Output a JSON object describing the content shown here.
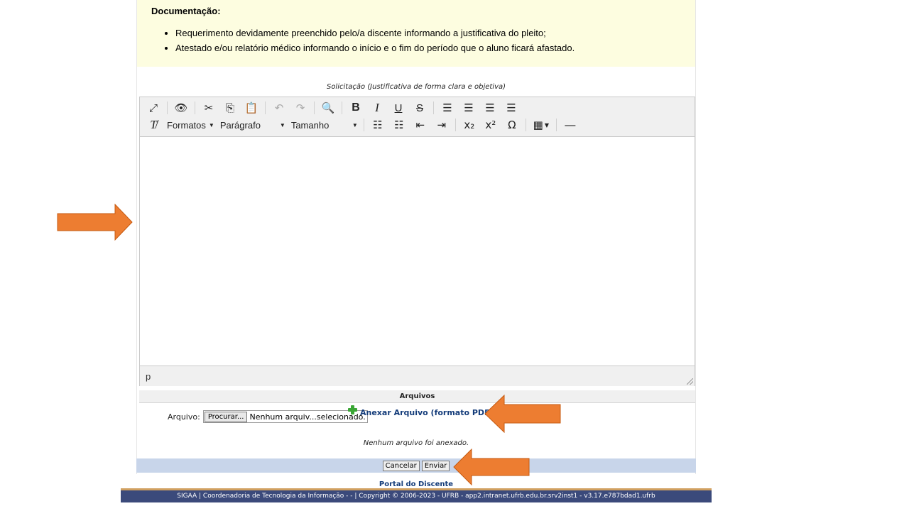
{
  "documentation": {
    "title": "Documentação:",
    "items": [
      "Requerimento devidamente preenchido pelo/a discente informando a justificativa do pleito;",
      "Atestado e/ou relatório médico informando o início e o fim do período que o aluno ficará afastado."
    ]
  },
  "solicitation_label": "Solicitação (Justificativa de forma clara e objetiva)",
  "editor": {
    "dropdowns": {
      "formats": "Formatos",
      "paragraph": "Parágrafo",
      "size": "Tamanho"
    },
    "status_path": "p",
    "content": ""
  },
  "attachments": {
    "title": "Arquivos",
    "file_label": "Arquivo:",
    "browse_label": "Procurar...",
    "file_status": "Nenhum arquiv...selecionado.",
    "attach_link": "Anexar Arquivo (formato PDF)",
    "none_attached": "Nenhum arquivo foi anexado."
  },
  "actions": {
    "cancel": "Cancelar",
    "send": "Enviar"
  },
  "portal_link": "Portal do Discente",
  "footer_text": "SIGAA | Coordenadoria de Tecnologia da Informação - - | Copyright © 2006-2023 - UFRB - app2.intranet.ufrb.edu.br.srv2inst1 - v3.17.e787bdad1.ufrb",
  "colors": {
    "annotation_arrow": "#ed7d31",
    "doc_background": "#fdfde0",
    "button_bar": "#c8d5ea",
    "footer": "#3b4a7b",
    "link": "#143c7a"
  }
}
